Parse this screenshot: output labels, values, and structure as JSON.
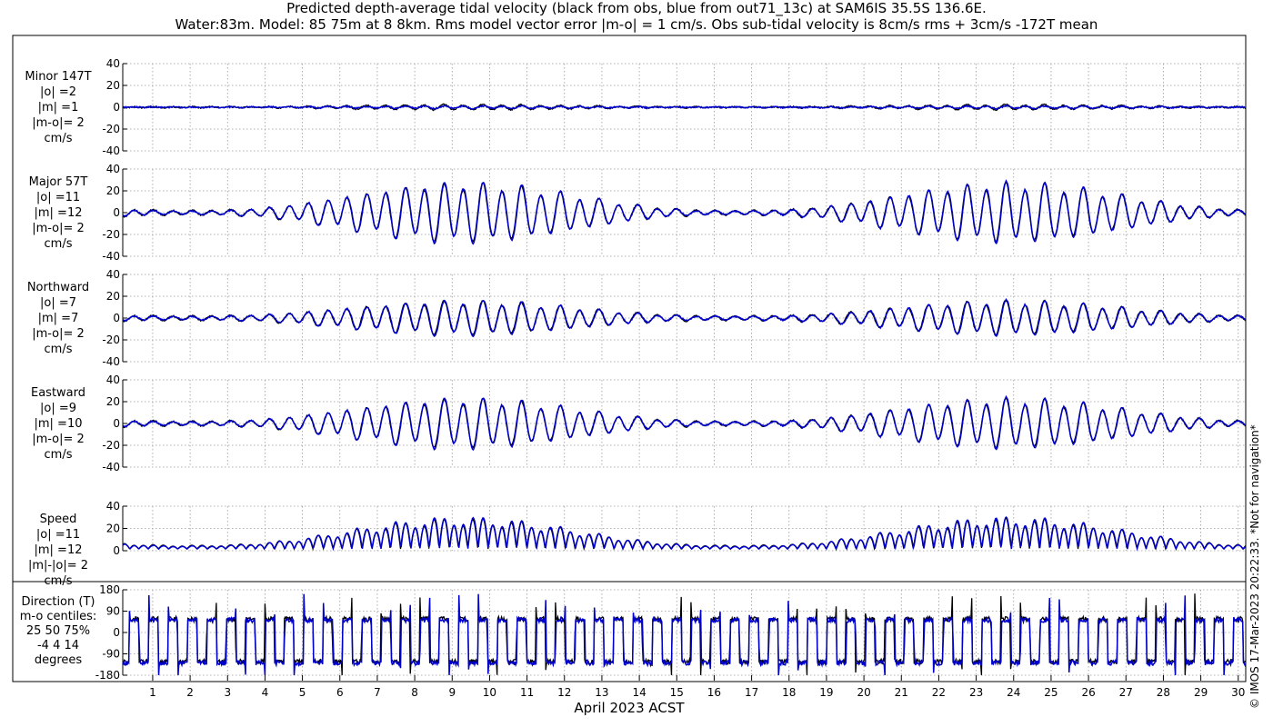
{
  "title": {
    "line1": "Predicted depth-average tidal velocity (black from obs, blue from out71_13c) at SAM6IS 35.5S 136.6E.",
    "line2": "Water:83m. Model: 85 75m at 8 8km. Rms model vector error |m-o| = 1 cm/s. Obs sub-tidal velocity is 8cm/s rms + 3cm/s -172T mean"
  },
  "copyright": "© IMOS 17-Mar-2023 20:22:33. *Not for navigation*",
  "colors": {
    "obs": "#000000",
    "model": "#0000cc",
    "grid": "#9a9a9a"
  },
  "chart_data": {
    "type": "line",
    "xlabel": "April 2023 ACST",
    "x_ticks": [
      1,
      2,
      3,
      4,
      5,
      6,
      7,
      8,
      9,
      10,
      11,
      12,
      13,
      14,
      15,
      16,
      17,
      18,
      19,
      20,
      21,
      22,
      23,
      24,
      25,
      26,
      27,
      28,
      29,
      30
    ],
    "xlim": [
      0.2,
      30.2
    ],
    "grid": true,
    "series_names": [
      "obs",
      "out71_13c"
    ],
    "panels": [
      {
        "id": "minor",
        "label": [
          "Minor 147T",
          "|o| =2",
          "|m| =1",
          "|m-o|= 2",
          "cm/s"
        ],
        "ylim": [
          -40,
          40
        ],
        "y_ticks": [
          -40,
          -20,
          0,
          20,
          40
        ],
        "series": [
          {
            "name": "obs",
            "amplitude": 2.2,
            "min_amp": 0.4,
            "phase": 0.3
          },
          {
            "name": "out71_13c",
            "amplitude": 1.1,
            "min_amp": 0.2,
            "phase": 0.1
          }
        ]
      },
      {
        "id": "major",
        "label": [
          "Major 57T",
          "|o| =11",
          "|m| =12",
          "|m-o|= 2",
          "cm/s"
        ],
        "ylim": [
          -40,
          40
        ],
        "y_ticks": [
          -40,
          -20,
          0,
          20,
          40
        ],
        "series": [
          {
            "name": "obs",
            "amplitude": 24,
            "min_amp": 2,
            "phase": 0.2
          },
          {
            "name": "out71_13c",
            "amplitude": 25,
            "min_amp": 1.5,
            "phase": 0.1
          }
        ]
      },
      {
        "id": "north",
        "label": [
          "Northward",
          "|o| =7",
          "|m| =7",
          "|m-o|= 2",
          "cm/s"
        ],
        "ylim": [
          -40,
          40
        ],
        "y_ticks": [
          -40,
          -20,
          0,
          20,
          40
        ],
        "series": [
          {
            "name": "obs",
            "amplitude": 14,
            "min_amp": 2,
            "phase": 0.25
          },
          {
            "name": "out71_13c",
            "amplitude": 14.5,
            "min_amp": 1.5,
            "phase": 0.1
          }
        ]
      },
      {
        "id": "east",
        "label": [
          "Eastward",
          "|o| =9",
          "|m| =10",
          "|m-o|= 2",
          "cm/s"
        ],
        "ylim": [
          -40,
          40
        ],
        "y_ticks": [
          -40,
          -20,
          0,
          20,
          40
        ],
        "series": [
          {
            "name": "obs",
            "amplitude": 20,
            "min_amp": 2,
            "phase": 0.2
          },
          {
            "name": "out71_13c",
            "amplitude": 21,
            "min_amp": 1.5,
            "phase": 0.1
          }
        ]
      },
      {
        "id": "speed",
        "label": [
          "Speed",
          "|o| =11",
          "|m| =12",
          "|m|-|o|= 2",
          "cm/s"
        ],
        "ylim": [
          0,
          40
        ],
        "y_ticks": [
          0,
          20,
          40
        ],
        "series": [
          {
            "name": "obs",
            "amplitude": 24,
            "min_amp": 3,
            "phase": 0.2
          },
          {
            "name": "out71_13c",
            "amplitude": 25,
            "min_amp": 2.5,
            "phase": 0.1
          }
        ]
      },
      {
        "id": "direction",
        "label": [
          "Direction (T)",
          "m-o centiles:",
          "25  50  75%",
          "-4   4  14",
          "degrees"
        ],
        "ylim": [
          -180,
          180
        ],
        "y_ticks": [
          -180,
          -90,
          0,
          90,
          180
        ],
        "series": [
          {
            "name": "obs",
            "flood_dir": 57,
            "ebb_dir": -123
          },
          {
            "name": "out71_13c",
            "flood_dir": 52,
            "ebb_dir": -128
          }
        ]
      }
    ]
  }
}
